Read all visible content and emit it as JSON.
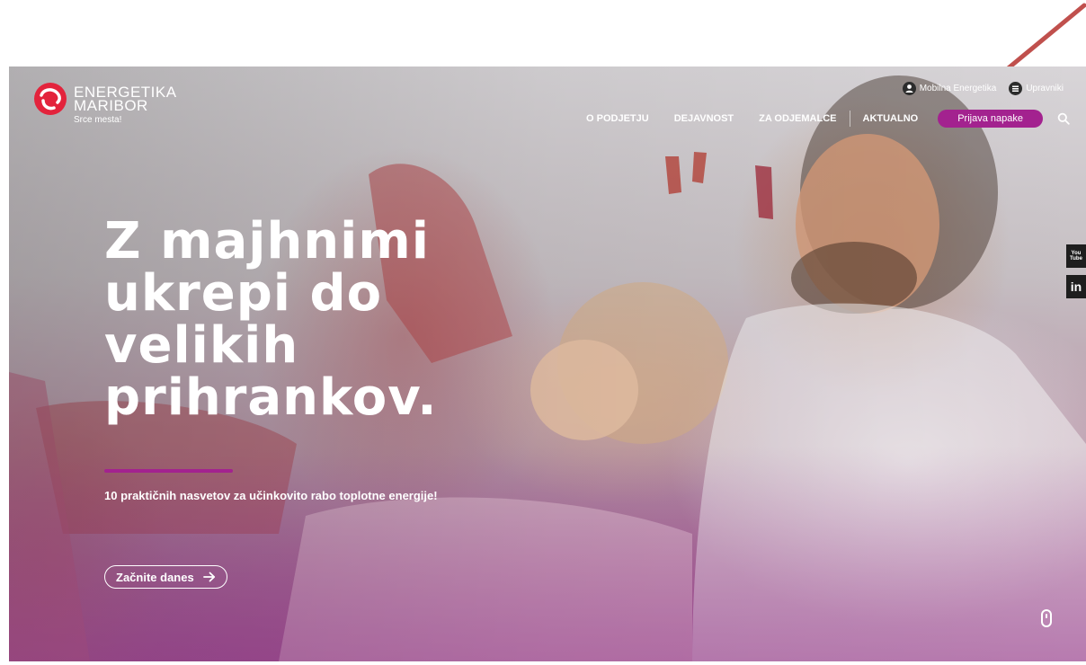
{
  "colors": {
    "brand_magenta": "#a3228f",
    "annotation_arrow": "#c0504d",
    "text_light": "#ffffff"
  },
  "header": {
    "logo": {
      "line1": "ENERGETIKA",
      "line2": "MARIBOR",
      "tagline": "Srce mesta!"
    },
    "top_links": [
      {
        "label": "Mobilna Energetika",
        "icon": "user-icon"
      },
      {
        "label": "Upravniki",
        "icon": "building-icon"
      }
    ],
    "nav": {
      "items": [
        "O PODJETJU",
        "DEJAVNOST",
        "ZA ODJEMALCE",
        "AKTUALNO"
      ],
      "cta_label": "Prijava napake",
      "search_icon": "search-icon"
    }
  },
  "hero": {
    "headline_lines": [
      "Z majhnimi",
      "ukrepi do",
      "velikih",
      "prihrankov."
    ],
    "subtitle": "10 praktičnih nasvetov za učinkovito rabo toplotne energije!",
    "button_label": "Začnite danes",
    "button_icon": "arrow-right-icon"
  },
  "social": {
    "youtube": "You Tube",
    "linkedin": "in"
  }
}
